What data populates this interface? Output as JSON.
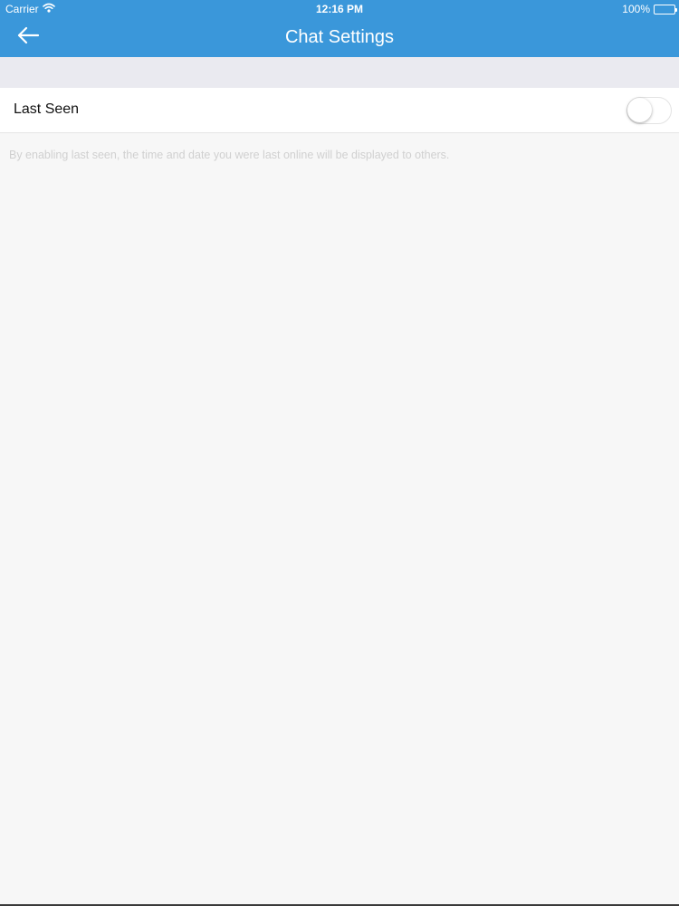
{
  "status_bar": {
    "carrier": "Carrier",
    "time": "12:16 PM",
    "battery": "100%",
    "battery_level": 1.0
  },
  "nav": {
    "title": "Chat Settings",
    "back_icon": "arrow-left-icon"
  },
  "settings": {
    "last_seen": {
      "label": "Last Seen",
      "enabled": false
    },
    "footnote": "By enabling last seen, the time and date you were last online will be displayed to others."
  },
  "colors": {
    "accent": "#3a97da",
    "background": "#f7f7f7",
    "section_header": "#eaeaf0"
  }
}
